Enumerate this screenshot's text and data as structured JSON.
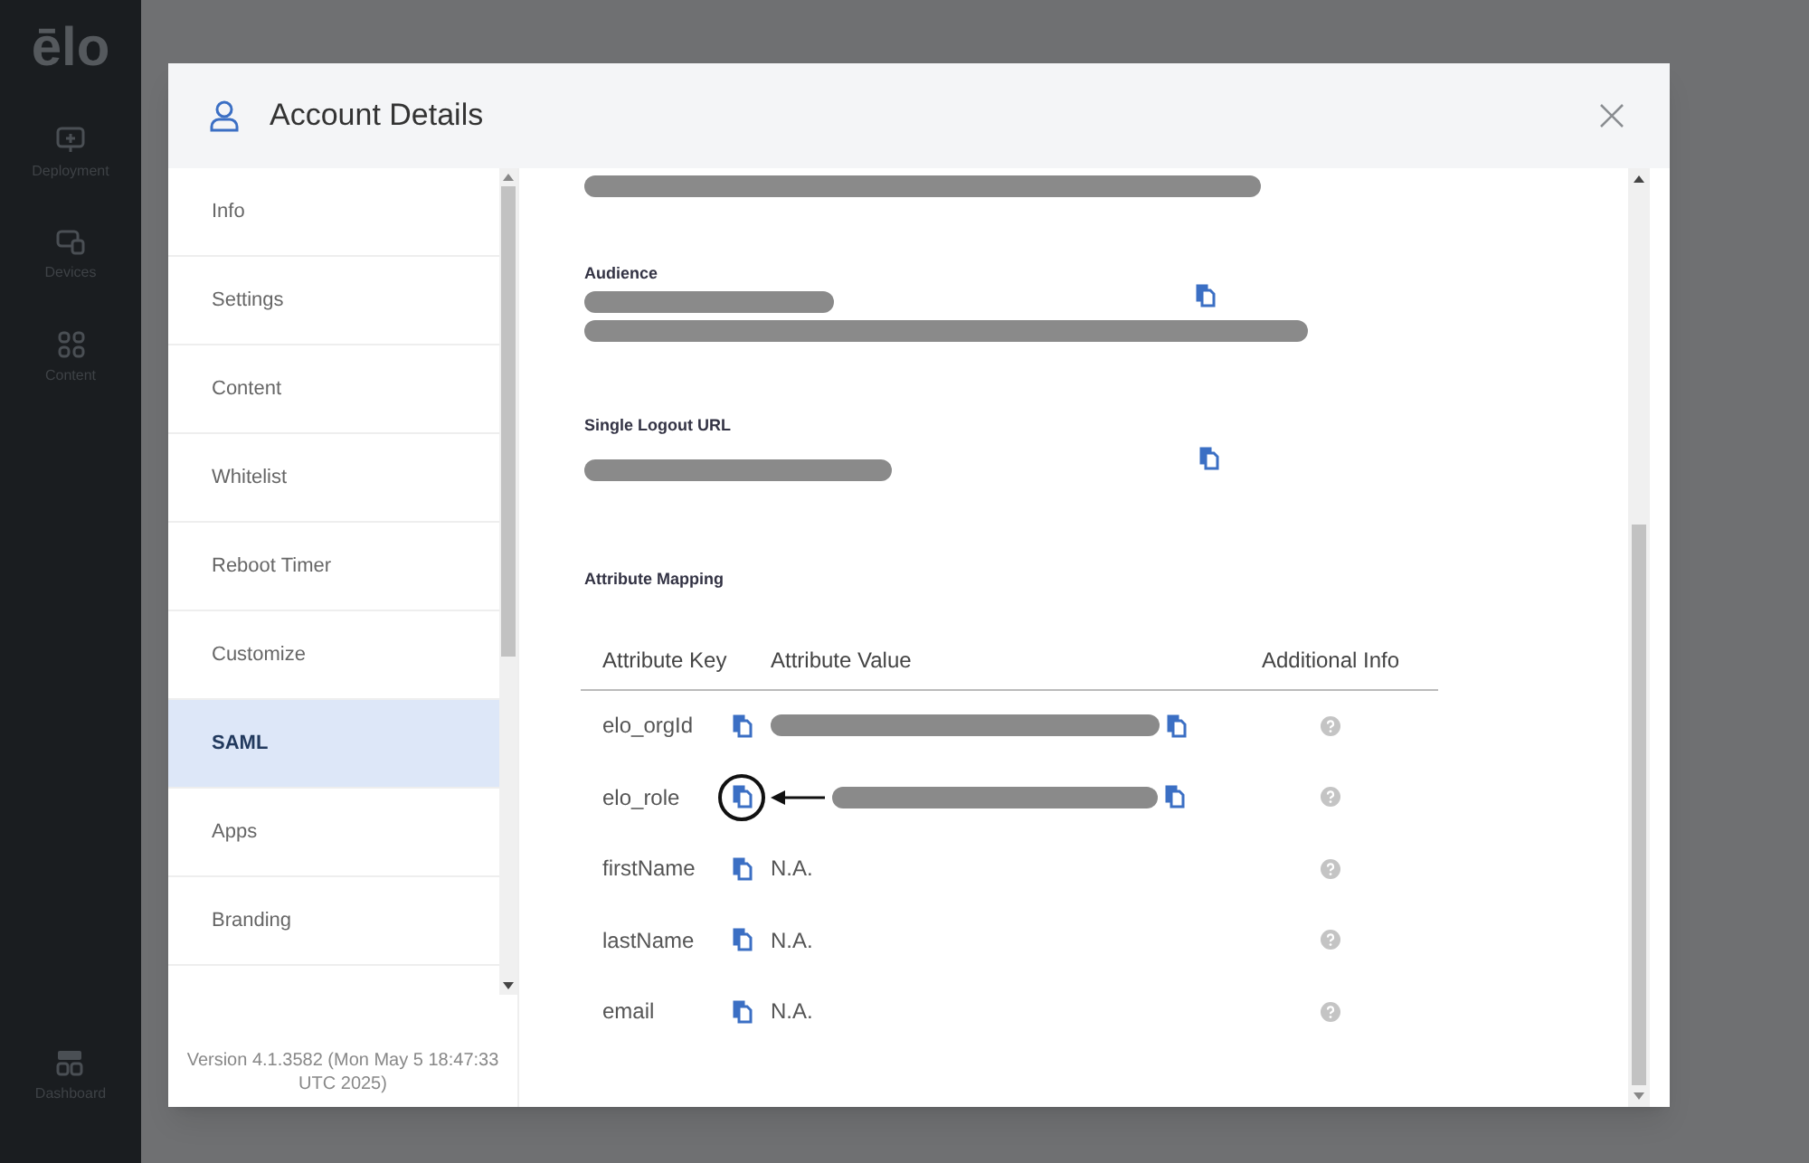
{
  "app_sidebar": {
    "logo": "ēlo",
    "items": [
      {
        "label": "Deployment",
        "kind": "monitor"
      },
      {
        "label": "Devices",
        "kind": "devices"
      },
      {
        "label": "Content",
        "kind": "grid"
      }
    ],
    "bottom_item": {
      "label": "Dashboard",
      "kind": "dashboard"
    }
  },
  "dialog": {
    "title": "Account Details",
    "nav": [
      {
        "label": "Info",
        "selected": false
      },
      {
        "label": "Settings",
        "selected": false
      },
      {
        "label": "Content",
        "selected": false
      },
      {
        "label": "Whitelist",
        "selected": false
      },
      {
        "label": "Reboot Timer",
        "selected": false
      },
      {
        "label": "Customize",
        "selected": false
      },
      {
        "label": "SAML",
        "selected": true
      },
      {
        "label": "Apps",
        "selected": false
      },
      {
        "label": "Branding",
        "selected": false
      }
    ],
    "version": "Version 4.1.3582 (Mon May 5 18:47:33 UTC 2025)",
    "fields": [
      {
        "label": "Audience"
      },
      {
        "label": "Single Logout URL"
      }
    ],
    "attribute_mapping": {
      "title": "Attribute Mapping",
      "columns": [
        "Attribute Key",
        "Attribute Value",
        "Additional Info"
      ],
      "rows": [
        {
          "key": "elo_orgId",
          "kind": "redacted",
          "annotated": false
        },
        {
          "key": "elo_role",
          "kind": "redacted",
          "annotated": true
        },
        {
          "key": "firstName",
          "kind": "text",
          "value": "N.A.",
          "annotated": false
        },
        {
          "key": "lastName",
          "kind": "text",
          "value": "N.A.",
          "annotated": false
        },
        {
          "key": "email",
          "kind": "text",
          "value": "N.A.",
          "annotated": false
        }
      ]
    }
  }
}
